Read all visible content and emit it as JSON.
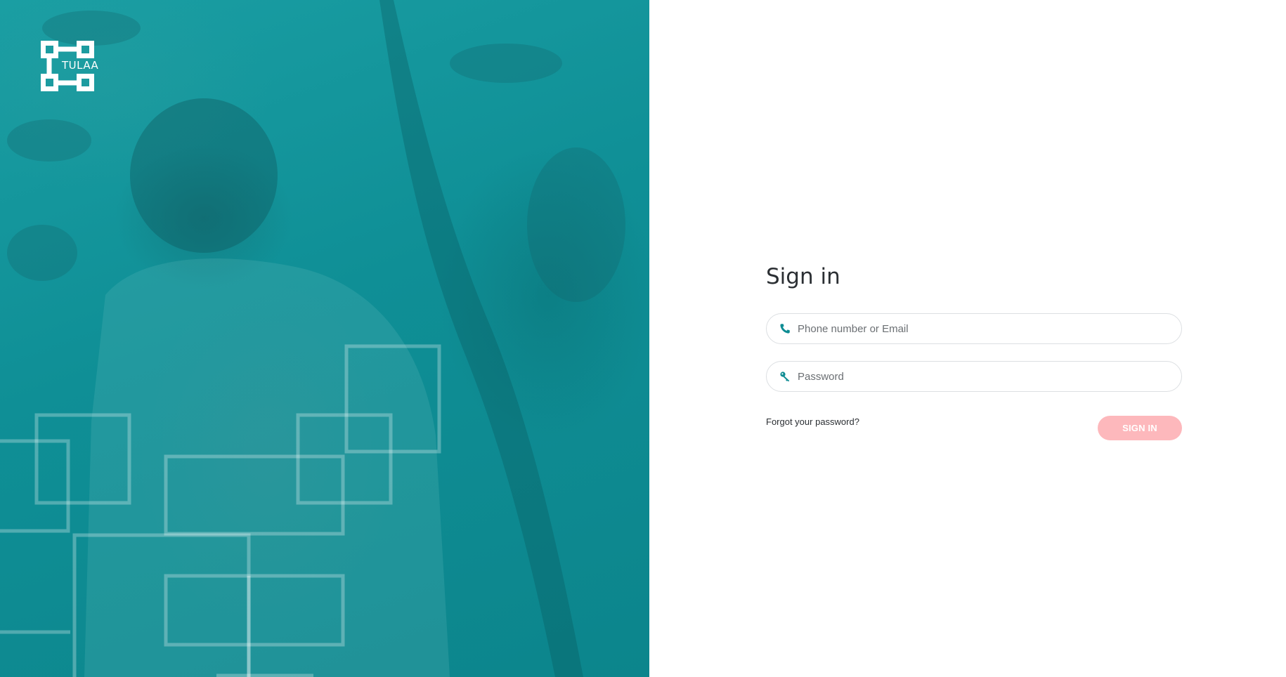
{
  "brand": {
    "name": "TULAA",
    "logo_icon": "tulaa-logo-icon"
  },
  "colors": {
    "hero_teal": "#0f8f96",
    "accent": "#0e8c93",
    "signin_button_bg": "#fdb8bc",
    "signin_button_text": "#ffffff"
  },
  "form": {
    "title": "Sign in",
    "identifier": {
      "placeholder": "Phone number or Email",
      "icon": "phone-icon"
    },
    "password": {
      "placeholder": "Password",
      "icon": "key-icon"
    },
    "forgot_label": "Forgot your password?",
    "submit_label": "SIGN IN"
  }
}
